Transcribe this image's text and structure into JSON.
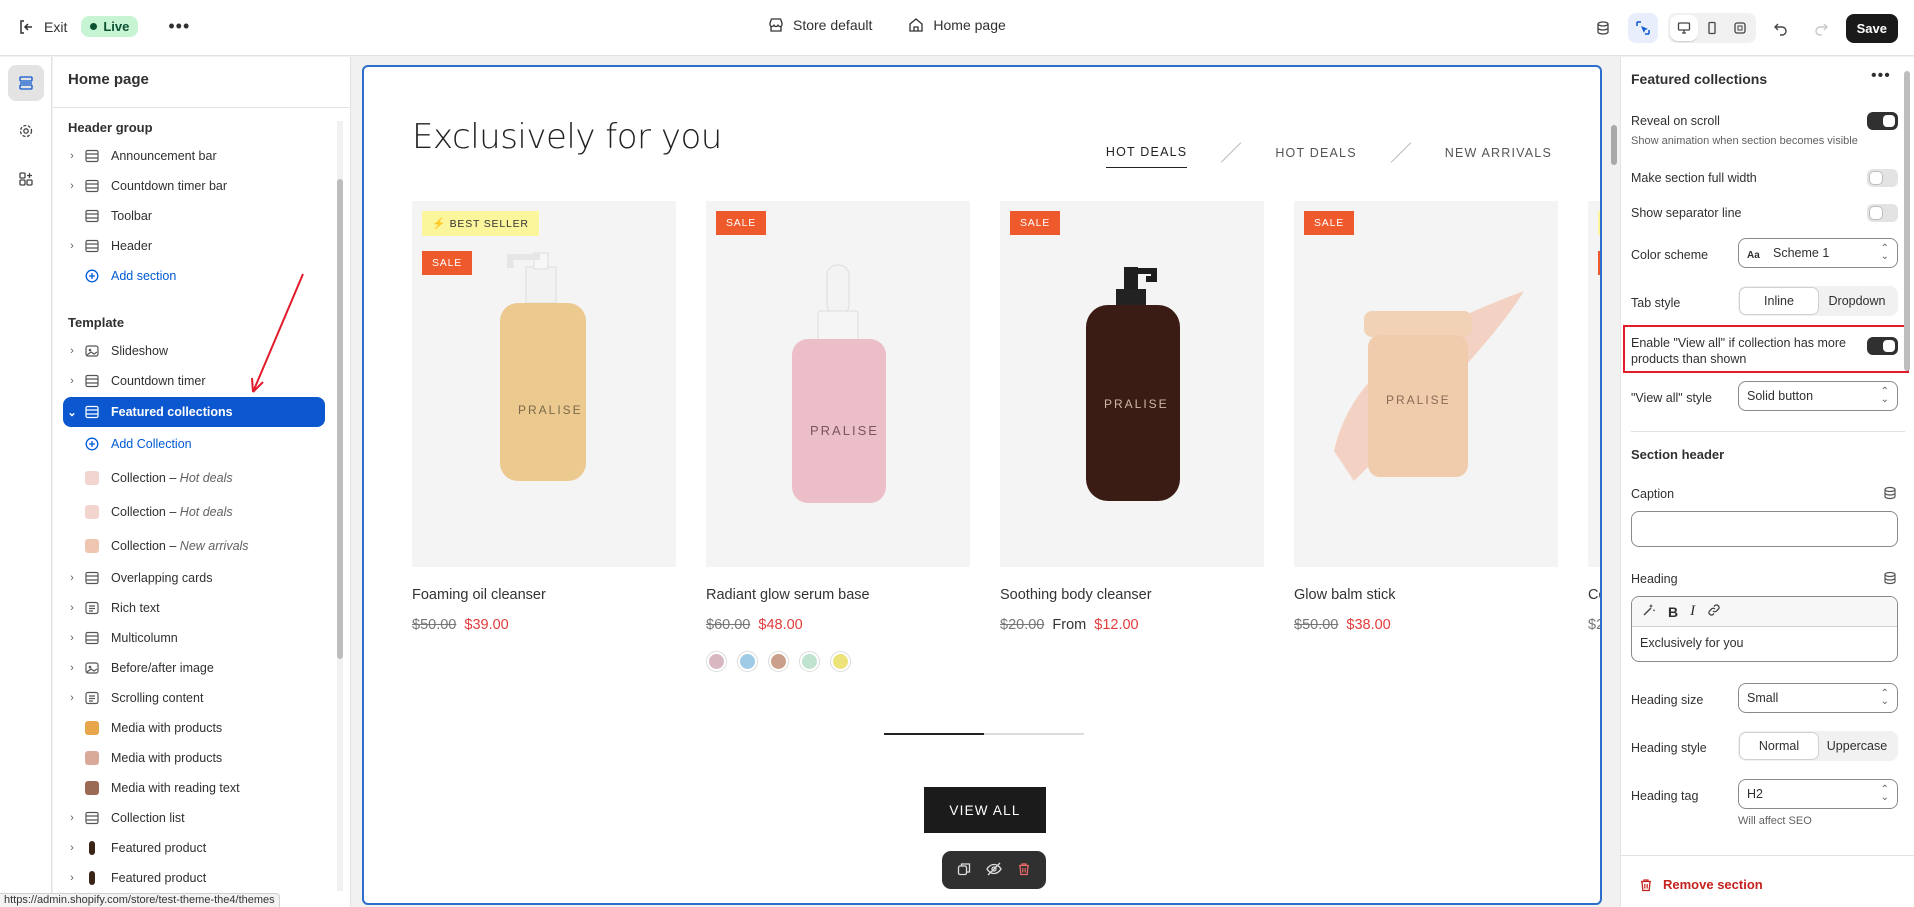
{
  "topbar": {
    "exit_label": "Exit",
    "live_label": "Live",
    "store_label": "Store default",
    "page_label": "Home page",
    "save_label": "Save"
  },
  "sidebar": {
    "title": "Home page",
    "header_group_title": "Header group",
    "header_items": [
      {
        "label": "Announcement bar",
        "icon": "section-icon"
      },
      {
        "label": "Countdown timer bar",
        "icon": "section-icon"
      },
      {
        "label": "Toolbar",
        "icon": "section-icon"
      },
      {
        "label": "Header",
        "icon": "section-icon"
      }
    ],
    "add_section_label": "Add section",
    "template_title": "Template",
    "template_items": [
      {
        "label": "Slideshow"
      },
      {
        "label": "Countdown timer"
      },
      {
        "label": "Featured collections"
      },
      {
        "label": "Overlapping cards"
      },
      {
        "label": "Rich text"
      },
      {
        "label": "Multicolumn"
      },
      {
        "label": "Before/after image"
      },
      {
        "label": "Scrolling content"
      },
      {
        "label": "Media with products"
      },
      {
        "label": "Media with products"
      },
      {
        "label": "Media with reading text"
      },
      {
        "label": "Collection list"
      },
      {
        "label": "Featured product"
      },
      {
        "label": "Featured product"
      }
    ],
    "add_collection_label": "Add Collection",
    "collection_blocks": [
      {
        "prefix": "Collection – ",
        "name": "Hot deals"
      },
      {
        "prefix": "Collection – ",
        "name": "Hot deals"
      },
      {
        "prefix": "Collection – ",
        "name": "New arrivals"
      }
    ]
  },
  "preview": {
    "heading": "Exclusively for you",
    "tabs": [
      "HOT DEALS",
      "HOT DEALS",
      "NEW ARRIVALS"
    ],
    "products": [
      {
        "name": "Foaming oil cleanser",
        "old_price": "$50.00",
        "price_prefix": "",
        "price": "$39.00",
        "badges": [
          "BEST SELLER",
          "SALE"
        ],
        "brand": "PRALISE"
      },
      {
        "name": "Radiant glow serum base",
        "old_price": "$60.00",
        "price_prefix": "",
        "price": "$48.00",
        "badges": [
          "SALE"
        ],
        "brand": "PRALISE",
        "swatches": [
          "#d9b7c0",
          "#9fcbe6",
          "#c9a08a",
          "#bfe3cf",
          "#ece37a"
        ]
      },
      {
        "name": "Soothing body cleanser",
        "old_price": "$20.00",
        "price_prefix": "From",
        "price": "$12.00",
        "badges": [
          "SALE"
        ],
        "brand": "PRALISE"
      },
      {
        "name": "Glow balm stick",
        "old_price": "$50.00",
        "price_prefix": "",
        "price": "$38.00",
        "badges": [
          "SALE"
        ],
        "brand": "PRALISE"
      }
    ],
    "partial_name": "Co",
    "partial_price": "$2",
    "carousel_progress": 0.5,
    "view_all_label": "VIEW ALL"
  },
  "settings": {
    "title": "Featured collections",
    "reveal_on_scroll": {
      "label": "Reveal on scroll",
      "help": "Show animation when section becomes visible",
      "value": true
    },
    "full_width": {
      "label": "Make section full width",
      "value": false
    },
    "separator": {
      "label": "Show separator line",
      "value": false
    },
    "color_scheme": {
      "label": "Color scheme",
      "value": "Scheme 1"
    },
    "tab_style": {
      "label": "Tab style",
      "options": [
        "Inline",
        "Dropdown"
      ],
      "selected": "Inline"
    },
    "view_all_enable": {
      "label": "Enable \"View all\" if collection has more products than shown",
      "value": true
    },
    "view_all_style": {
      "label": "\"View all\" style",
      "value": "Solid button"
    },
    "section_header_title": "Section header",
    "caption": {
      "label": "Caption",
      "value": ""
    },
    "heading": {
      "label": "Heading",
      "value": "Exclusively for you"
    },
    "heading_size": {
      "label": "Heading size",
      "value": "Small"
    },
    "heading_style": {
      "label": "Heading style",
      "options": [
        "Normal",
        "Uppercase"
      ],
      "selected": "Normal"
    },
    "heading_tag": {
      "label": "Heading tag",
      "value": "H2",
      "help": "Will affect SEO"
    },
    "remove_label": "Remove section"
  },
  "statusbar": {
    "url": "https://admin.shopify.com/store/test-theme-the4/themes"
  },
  "colors": {
    "accent": "#0b57d0",
    "sale": "#ef5a2c",
    "price_red": "#e33b3b",
    "highlight": "#e21b2b",
    "live_bg": "#c7f5d4"
  }
}
